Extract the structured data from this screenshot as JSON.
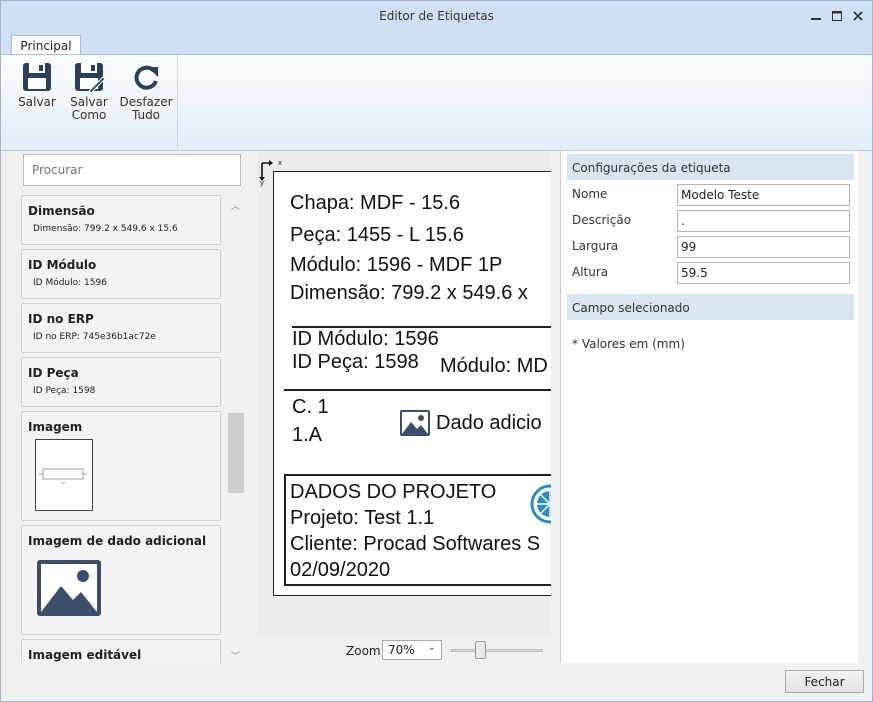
{
  "window": {
    "title": "Editor de Etiquetas"
  },
  "tabs": [
    {
      "label": "Principal"
    }
  ],
  "ribbon": {
    "save_label_line1": "Salvar",
    "save_as_line1": "Salvar",
    "save_as_line2": "Como",
    "undo_line1": "Desfazer",
    "undo_line2": "Tudo"
  },
  "search": {
    "placeholder": "Procurar"
  },
  "items": [
    {
      "name": "Dimensão",
      "sub": "Dimensão: 799.2 x 549.6 x 15.6"
    },
    {
      "name": "ID Módulo",
      "sub": "ID Módulo: 1596"
    },
    {
      "name": "ID no ERP",
      "sub": "ID no ERP: 745e36b1ac72e"
    },
    {
      "name": "ID Peça",
      "sub": "ID Peça: 1598"
    },
    {
      "name": "Imagem"
    },
    {
      "name": "Imagem de dado adicional"
    },
    {
      "name": "Imagem editável"
    }
  ],
  "label": {
    "chapa": "Chapa: MDF - 15.6",
    "peca": "Peça: 1455 - L 15.6",
    "modulo": "Módulo: 1596 - MDF 1P",
    "dimensao": "Dimensão: 799.2 x 549.6 x",
    "id_modulo": "ID Módulo: 1596",
    "id_peca": "ID Peça: 1598",
    "modulo_cut": "Módulo: MD",
    "c1": "C. 1",
    "c1a": "1.A",
    "dado_adicional": "Dado adicio",
    "dados_projeto": "DADOS DO PROJETO",
    "projeto": "Projeto: Test 1.1",
    "cliente": "Cliente: Procad Softwares S",
    "data": "02/09/2020",
    "axis_x": "x",
    "axis_y": "y"
  },
  "zoom": {
    "label": "Zoom",
    "value": "70%"
  },
  "config": {
    "header": "Configurações da etiqueta",
    "fields": [
      {
        "label": "Nome",
        "value": "Modelo Teste"
      },
      {
        "label": "Descrição",
        "value": "."
      },
      {
        "label": "Largura",
        "value": "99"
      },
      {
        "label": "Altura",
        "value": "59.5"
      }
    ],
    "selected_header": "Campo selecionado",
    "note": "* Valores em (mm)"
  },
  "footer": {
    "close_label": "Fechar"
  }
}
